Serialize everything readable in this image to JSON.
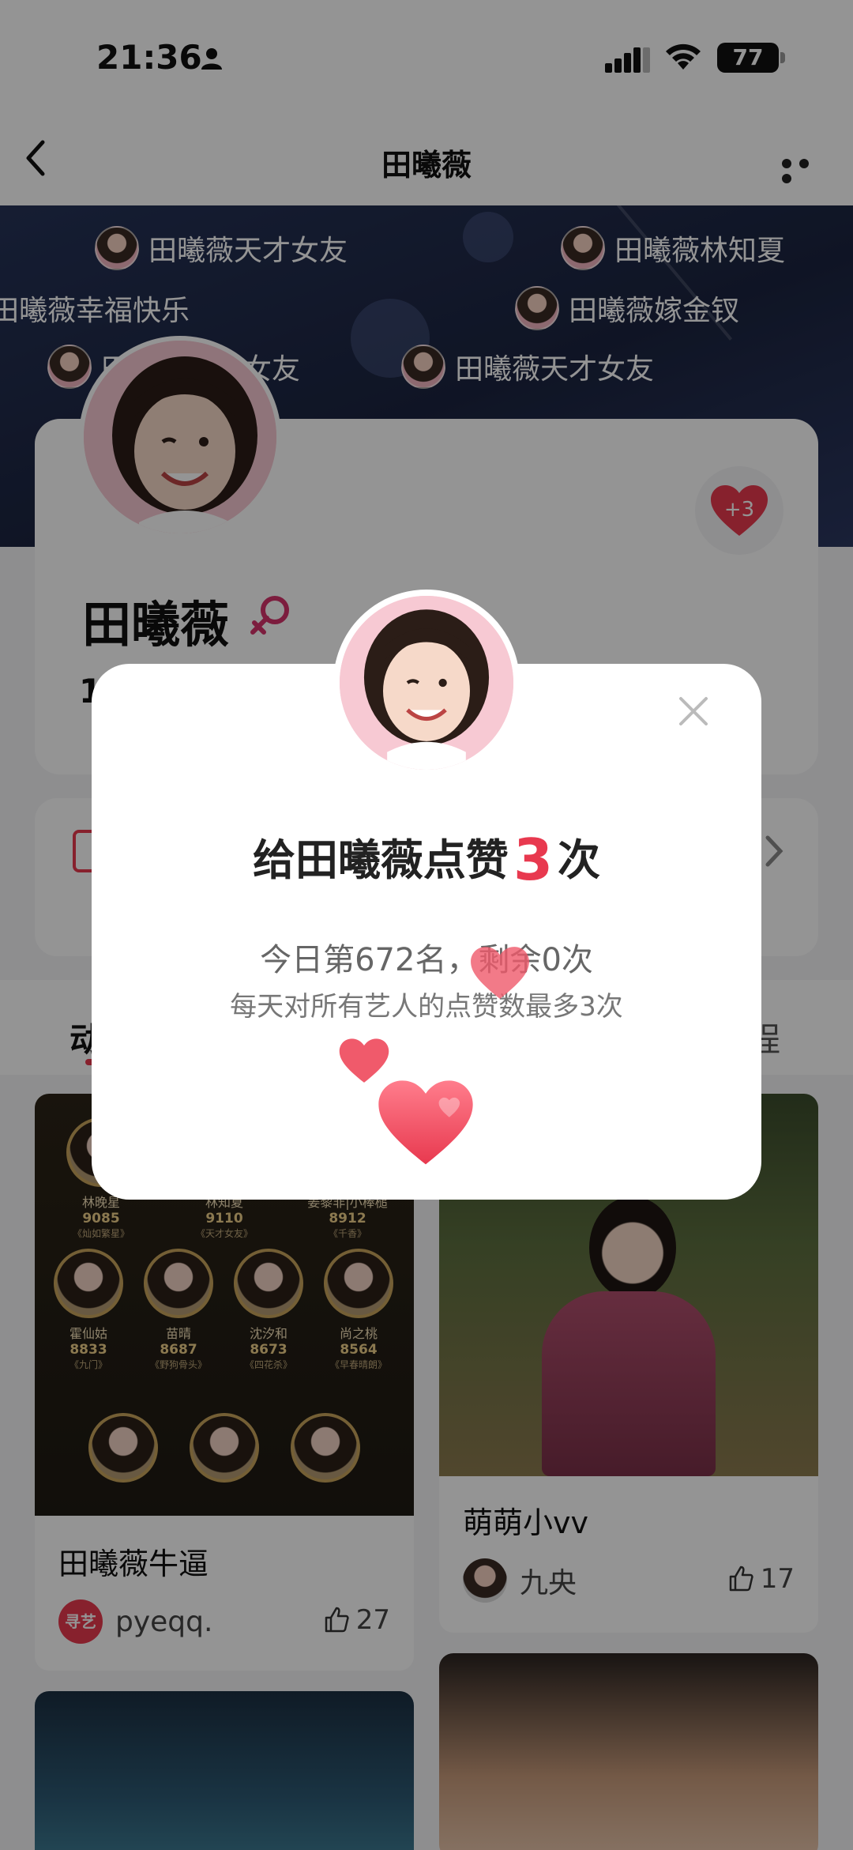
{
  "status_bar": {
    "time": "21:36",
    "battery": "77"
  },
  "nav": {
    "title": "田曦薇"
  },
  "banner": {
    "bubbles": [
      "田曦薇天才女友",
      "田曦薇林知夏",
      "田曦薇幸福快乐",
      "田曦薇嫁金钗",
      "田曦薇天才女友",
      "田曦薇天才女友"
    ]
  },
  "profile": {
    "name": "田曦薇",
    "like_badge": "+3",
    "stat_partial": "1"
  },
  "tabs": {
    "left": "动",
    "right": "程"
  },
  "posts": [
    {
      "title": "田曦薇牛逼",
      "author": "pyeqq.",
      "author_badge": "寻艺",
      "likes": "27",
      "ranking": [
        {
          "name": "林晚星",
          "score": "9085",
          "role": "《灿如繁星》"
        },
        {
          "name": "林知夏",
          "score": "9110",
          "role": "《天才女友》"
        },
        {
          "name": "姜黎非|小棒槌",
          "score": "8912",
          "role": "《千香》"
        },
        {
          "name": "霍仙姑",
          "score": "8833",
          "role": "《九门》"
        },
        {
          "name": "苗晴",
          "score": "8687",
          "role": "《野狗骨头》"
        },
        {
          "name": "沈汐和",
          "score": "8673",
          "role": "《四花杀》"
        },
        {
          "name": "尚之桃",
          "score": "8564",
          "role": "《早春晴朗》"
        }
      ]
    },
    {
      "title": "萌萌小vv",
      "author": "九央",
      "likes": "17"
    }
  ],
  "dialog": {
    "title_prefix": "给田曦薇点赞",
    "title_count": "3",
    "title_suffix": "次",
    "rank_text": "今日第672名，剩余0次",
    "limit_text": "每天对所有艺人的点赞数最多3次"
  },
  "colors": {
    "accent": "#e8394f",
    "banner": "#1b2440"
  }
}
